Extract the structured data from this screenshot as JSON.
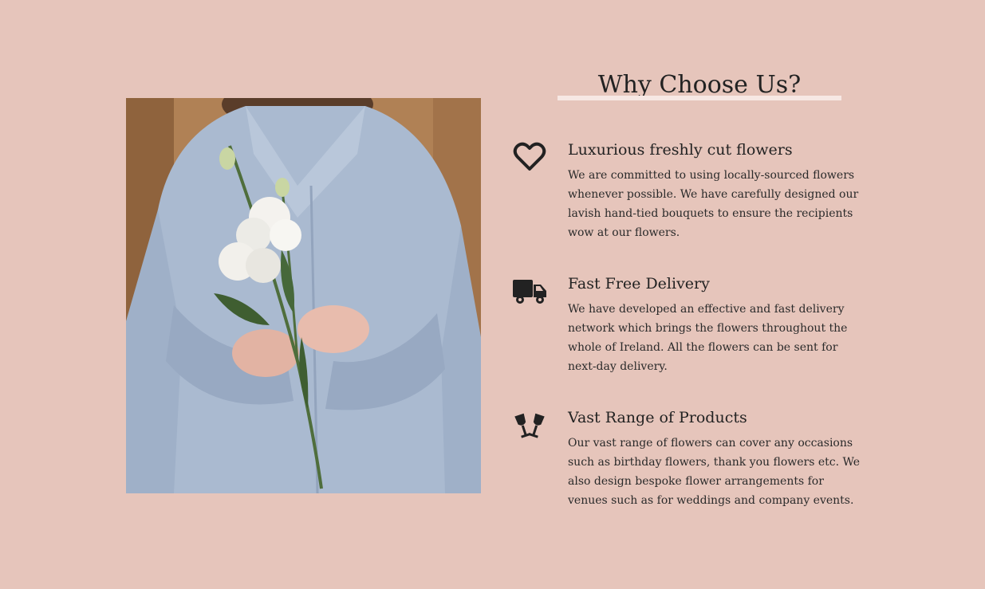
{
  "section": {
    "title": "Why Choose Us?"
  },
  "photo": {
    "icon": "woman-holding-flowers-photo"
  },
  "features": [
    {
      "icon": "heart-icon",
      "title": "Luxurious freshly cut flowers",
      "description": "We are committed to using locally-sourced flowers whenever possible. We have carefully designed our lavish hand-tied bouquets to ensure the recipients wow at our flowers."
    },
    {
      "icon": "truck-icon",
      "title": "Fast Free Delivery",
      "description": "We have developed an effective and fast delivery network which brings the flowers throughout the whole of Ireland. All the flowers can be sent for next-day delivery."
    },
    {
      "icon": "champagne-glasses-icon",
      "title": "Vast Range of Products",
      "description": "Our vast range of flowers can cover any occasions such as birthday flowers, thank you flowers etc. We also design bespoke flower arrangements for venues such as for weddings and company events."
    }
  ],
  "colors": {
    "background": "#e6c5bb",
    "text": "#222222",
    "underline": "#f7e8e4"
  }
}
